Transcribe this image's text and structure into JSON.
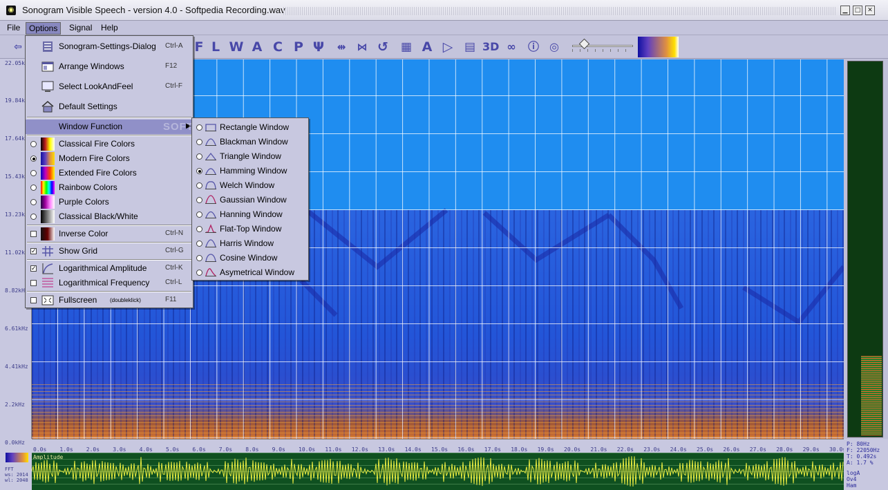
{
  "window": {
    "title": "Sonogram Visible Speech - version 4.0 - Softpedia Recording.wav",
    "logo_icon": "sonogram-logo-icon"
  },
  "menubar": {
    "file": "File",
    "options": "Options",
    "signal": "Signal",
    "help": "Help"
  },
  "options_menu": {
    "settings_dialog": {
      "label": "Sonogram-Settings-Dialog",
      "shortcut": "Ctrl-A"
    },
    "arrange_windows": {
      "label": "Arrange Windows",
      "shortcut": "F12"
    },
    "select_lookandfeel": {
      "label": "Select LookAndFeel",
      "shortcut": "Ctrl-F"
    },
    "default_settings": {
      "label": "Default Settings"
    },
    "window_function": {
      "label": "Window Function"
    },
    "colors": [
      {
        "label": "Classical Fire Colors",
        "selected": false
      },
      {
        "label": "Modern Fire Colors",
        "selected": true
      },
      {
        "label": "Extended Fire Colors",
        "selected": false
      },
      {
        "label": "Rainbow Colors",
        "selected": false
      },
      {
        "label": "Purple Colors",
        "selected": false
      },
      {
        "label": "Classical Black/White",
        "selected": false
      }
    ],
    "inverse_color": {
      "label": "Inverse Color",
      "shortcut": "Ctrl-N",
      "checked": false
    },
    "show_grid": {
      "label": "Show Grid",
      "shortcut": "Ctrl-G",
      "checked": true
    },
    "log_amplitude": {
      "label": "Logarithmical Amplitude",
      "shortcut": "Ctrl-K",
      "checked": true
    },
    "log_frequency": {
      "label": "Logarithmical Frequency",
      "shortcut": "Ctrl-L",
      "checked": false
    },
    "fullscreen": {
      "label": "Fullscreen",
      "note": "(doubleklick)",
      "shortcut": "F11",
      "checked": false
    }
  },
  "window_function_menu": [
    {
      "label": "Rectangle Window",
      "selected": false
    },
    {
      "label": "Blackman Window",
      "selected": false
    },
    {
      "label": "Triangle  Window",
      "selected": false
    },
    {
      "label": "Hamming Window",
      "selected": true
    },
    {
      "label": "Welch Window",
      "selected": false
    },
    {
      "label": "Gaussian Window",
      "selected": false
    },
    {
      "label": "Hanning Window",
      "selected": false
    },
    {
      "label": "Flat-Top Window",
      "selected": false
    },
    {
      "label": "Harris Window",
      "selected": false
    },
    {
      "label": "Cosine Window",
      "selected": false
    },
    {
      "label": "Asymetrical Window",
      "selected": false
    }
  ],
  "watermark": "SOFT",
  "frequency_labels": [
    "22.05k",
    "19.84k",
    "17.64k",
    "15.43k",
    "13.23k",
    "11.02k",
    "8.82kHz",
    "6.61kHz",
    "4.41kHz",
    "2.2kHz",
    "0.0kHz"
  ],
  "time_labels": [
    "0.0s",
    "1.0s",
    "2.0s",
    "3.0s",
    "4.0s",
    "5.0s",
    "6.0s",
    "7.0s",
    "8.0s",
    "9.0s",
    "10.0s",
    "11.0s",
    "12.0s",
    "13.0s",
    "14.0s",
    "15.0s",
    "16.0s",
    "17.0s",
    "18.0s",
    "19.0s",
    "20.0s",
    "21.0s",
    "22.0s",
    "23.0s",
    "24.0s",
    "25.0s",
    "26.0s",
    "27.0s",
    "28.0s",
    "29.0s",
    "30.0s"
  ],
  "waveform": {
    "label": "Amplitude"
  },
  "left_info": {
    "line1": "FFT",
    "line2": "ws: 2014",
    "line3": "wl: 2048"
  },
  "stats": {
    "p": "P: 80Hz",
    "f": "F: 22050Hz",
    "t": "T: 0.492s",
    "a": "A: 1.7 %",
    "log": "logA",
    "ov": "Ov4",
    "win": "Ham"
  },
  "toolbar_icons": [
    "cursor-icon",
    "letter-f-icon",
    "letter-l-icon",
    "letter-w-icon",
    "letter-a-icon",
    "letter-c-icon",
    "letter-p-icon",
    "psi-icon",
    "forward-icon",
    "backward-icon",
    "rewind-icon",
    "grid-icon",
    "formant-icon",
    "play-icon",
    "film-icon",
    "3d-icon",
    "binocular-icon",
    "info-icon",
    "help-icon"
  ]
}
